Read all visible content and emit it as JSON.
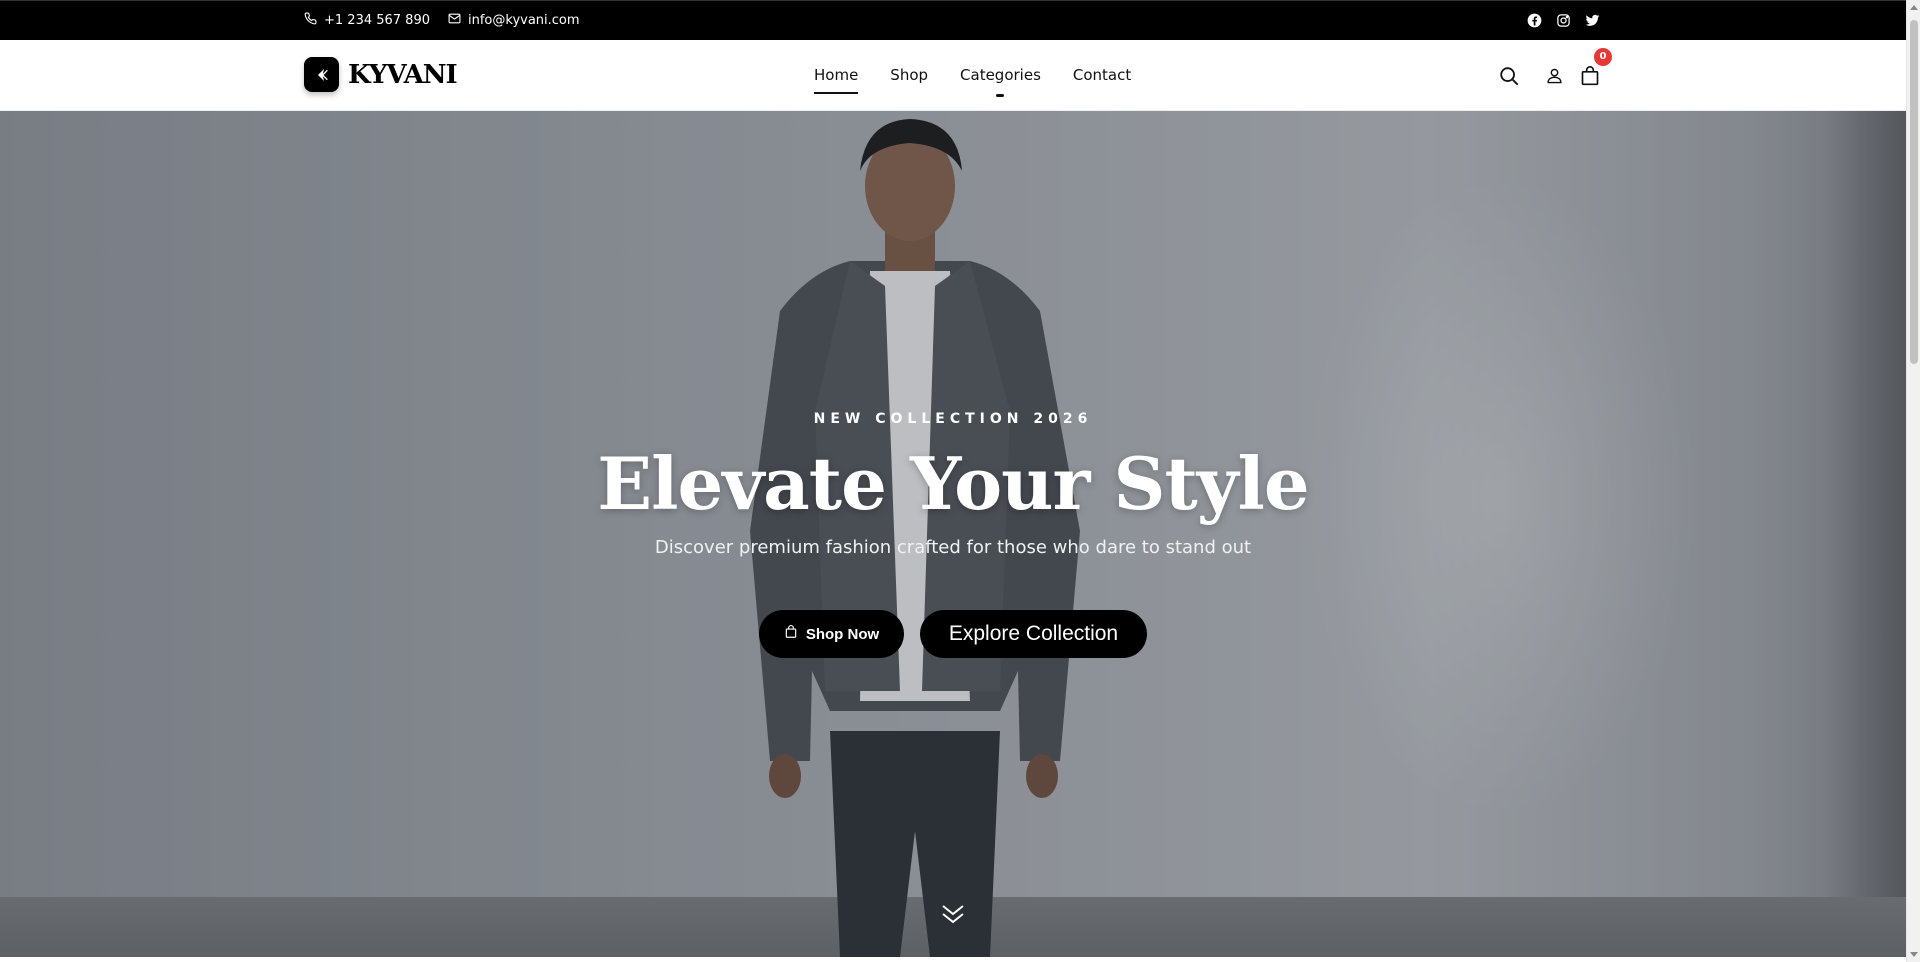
{
  "topbar": {
    "phone": "+1 234 567 890",
    "email": "info@kyvani.com",
    "socials": [
      "facebook-icon",
      "instagram-icon",
      "twitter-icon"
    ]
  },
  "header": {
    "logo_text": "KYVANI",
    "nav": [
      {
        "label": "Home",
        "active": true
      },
      {
        "label": "Shop",
        "active": false
      },
      {
        "label": "Categories",
        "active": false
      },
      {
        "label": "Contact",
        "active": false
      }
    ],
    "cart_count": "0"
  },
  "hero": {
    "eyebrow": "NEW COLLECTION 2026",
    "title": "Elevate Your Style",
    "subtitle": "Discover premium fashion crafted for those who dare to stand out",
    "primary_button": "Shop Now",
    "secondary_button": "Explore Collection"
  },
  "colors": {
    "topbar_bg": "#000000",
    "accent": "#000000",
    "badge": "#e53935"
  }
}
